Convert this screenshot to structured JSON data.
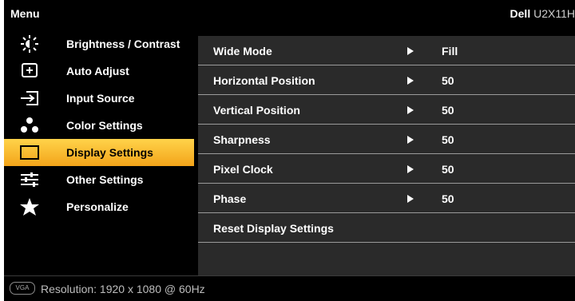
{
  "title": "Menu",
  "brand": "Dell",
  "model": "U2X11H",
  "sidebar": {
    "items": [
      {
        "label": "Brightness / Contrast",
        "icon": "brightness-icon"
      },
      {
        "label": "Auto Adjust",
        "icon": "auto-adjust-icon"
      },
      {
        "label": "Input Source",
        "icon": "input-source-icon"
      },
      {
        "label": "Color Settings",
        "icon": "color-settings-icon"
      },
      {
        "label": "Display Settings",
        "icon": "display-settings-icon",
        "active": true
      },
      {
        "label": "Other Settings",
        "icon": "other-settings-icon"
      },
      {
        "label": "Personalize",
        "icon": "star-icon"
      }
    ]
  },
  "main": {
    "rows": [
      {
        "label": "Wide Mode",
        "value": "Fill"
      },
      {
        "label": "Horizontal Position",
        "value": "50"
      },
      {
        "label": "Vertical Position",
        "value": "50"
      },
      {
        "label": "Sharpness",
        "value": "50"
      },
      {
        "label": "Pixel Clock",
        "value": "50"
      },
      {
        "label": "Phase",
        "value": "50"
      },
      {
        "label": "Reset Display Settings",
        "value": ""
      }
    ]
  },
  "footer": {
    "connector": "VGA",
    "resolution": "Resolution: 1920 x 1080 @ 60Hz"
  },
  "colors": {
    "accent": "#f3a41a",
    "background": "#000000",
    "panel": "#2a2a2a"
  }
}
